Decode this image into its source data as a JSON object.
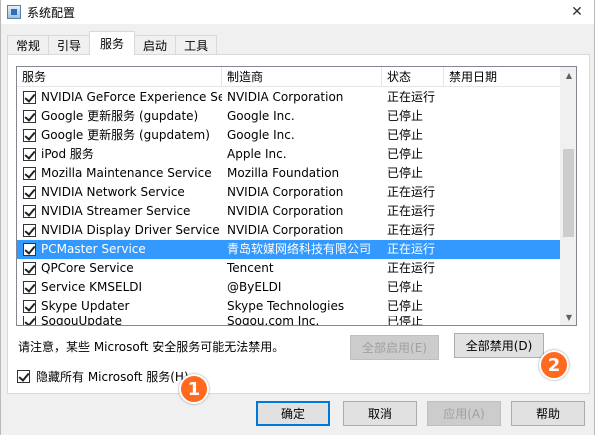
{
  "window": {
    "title": "系统配置",
    "close_glyph": "✕"
  },
  "tabs": [
    {
      "label": "常规"
    },
    {
      "label": "引导"
    },
    {
      "label": "服务"
    },
    {
      "label": "启动"
    },
    {
      "label": "工具"
    }
  ],
  "active_tab": "服务",
  "list": {
    "headers": [
      "服务",
      "制造商",
      "状态",
      "禁用日期"
    ],
    "rows": [
      {
        "name": "NVIDIA GeForce Experience Service",
        "vendor": "NVIDIA Corporation",
        "status": "正在运行",
        "checked": true
      },
      {
        "name": "Google 更新服务 (gupdate)",
        "vendor": "Google Inc.",
        "status": "已停止",
        "checked": true
      },
      {
        "name": "Google 更新服务 (gupdatem)",
        "vendor": "Google Inc.",
        "status": "已停止",
        "checked": true
      },
      {
        "name": "iPod 服务",
        "vendor": "Apple Inc.",
        "status": "已停止",
        "checked": true
      },
      {
        "name": "Mozilla Maintenance Service",
        "vendor": "Mozilla Foundation",
        "status": "已停止",
        "checked": true
      },
      {
        "name": "NVIDIA Network Service",
        "vendor": "NVIDIA Corporation",
        "status": "正在运行",
        "checked": true
      },
      {
        "name": "NVIDIA Streamer Service",
        "vendor": "NVIDIA Corporation",
        "status": "正在运行",
        "checked": true
      },
      {
        "name": "NVIDIA Display Driver Service",
        "vendor": "NVIDIA Corporation",
        "status": "正在运行",
        "checked": true
      },
      {
        "name": "PCMaster Service",
        "vendor": "青岛软媒网络科技有限公司",
        "status": "正在运行",
        "checked": true,
        "selected": true
      },
      {
        "name": "QPCore Service",
        "vendor": "Tencent",
        "status": "正在运行",
        "checked": true
      },
      {
        "name": "Service KMSELDI",
        "vendor": "@ByELDI",
        "status": "已停止",
        "checked": true
      },
      {
        "name": "Skype Updater",
        "vendor": "Skype Technologies",
        "status": "已停止",
        "checked": true
      },
      {
        "name": "SogouUpdate",
        "vendor": "Sogou.com Inc.",
        "status": "已停止",
        "checked": true
      }
    ]
  },
  "notice_text": "请注意，某些 Microsoft 安全服务可能无法禁用。",
  "buttons": {
    "enable_all": "全部启用(E)",
    "disable_all": "全部禁用(D)",
    "ok": "确定",
    "cancel": "取消",
    "apply": "应用(A)",
    "help": "帮助"
  },
  "hide_ms_label": "隐藏所有 Microsoft 服务(H)",
  "hide_ms_checked": true,
  "callouts": [
    "1",
    "2"
  ],
  "colors": {
    "selection": "#3399ff",
    "callout": "#ff6a1f",
    "focus_border": "#0078d7"
  }
}
